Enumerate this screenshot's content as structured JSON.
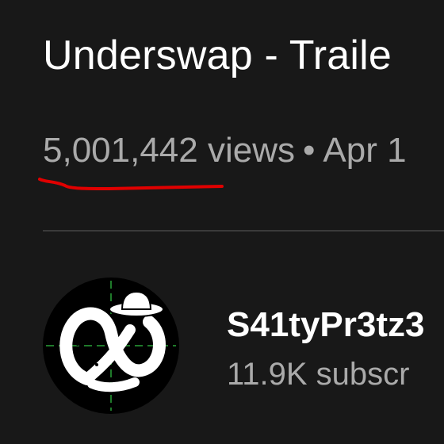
{
  "video": {
    "title": "Underswap - Traile",
    "views": "5,001,442 views",
    "separator": "•",
    "date": "Apr 1"
  },
  "channel": {
    "name": "S41tyPr3tz3",
    "subscribers": "11.9K subscr",
    "avatar_icon": "pretzel-cowboy-hat-icon"
  },
  "colors": {
    "background": "#181818",
    "primary_text": "#ffffff",
    "secondary_text": "#aaaaaa",
    "annotation_underline": "#e00000"
  }
}
